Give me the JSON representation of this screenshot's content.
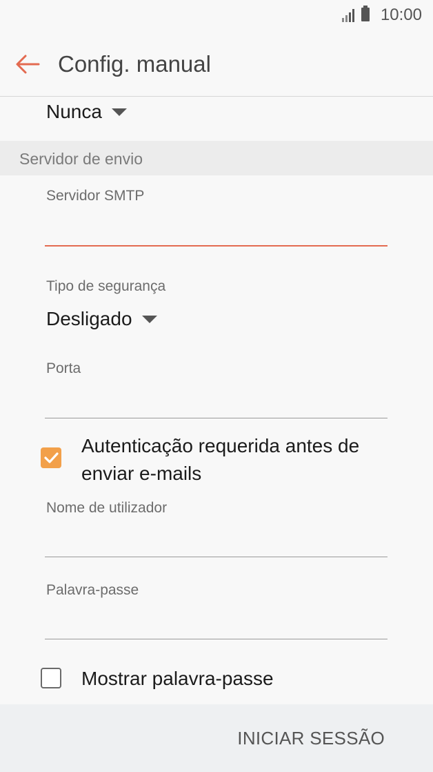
{
  "status": {
    "time": "10:00"
  },
  "header": {
    "title": "Config. manual"
  },
  "sync_dropdown": {
    "value": "Nunca"
  },
  "outgoing": {
    "section_title": "Servidor de envio",
    "smtp_label": "Servidor SMTP",
    "smtp_value": "",
    "security_label": "Tipo de segurança",
    "security_value": "Desligado",
    "port_label": "Porta",
    "port_value": "",
    "auth_label": "Autenticação requerida antes de enviar e-mails",
    "auth_checked": true,
    "username_label": "Nome de utilizador",
    "username_value": "",
    "password_label": "Palavra-passe",
    "password_value": "",
    "show_password_label": "Mostrar palavra-passe",
    "show_password_checked": false
  },
  "footer": {
    "login_label": "INICIAR SESSÃO"
  },
  "colors": {
    "accent": "#e36a50",
    "checkbox": "#f2a04a"
  }
}
